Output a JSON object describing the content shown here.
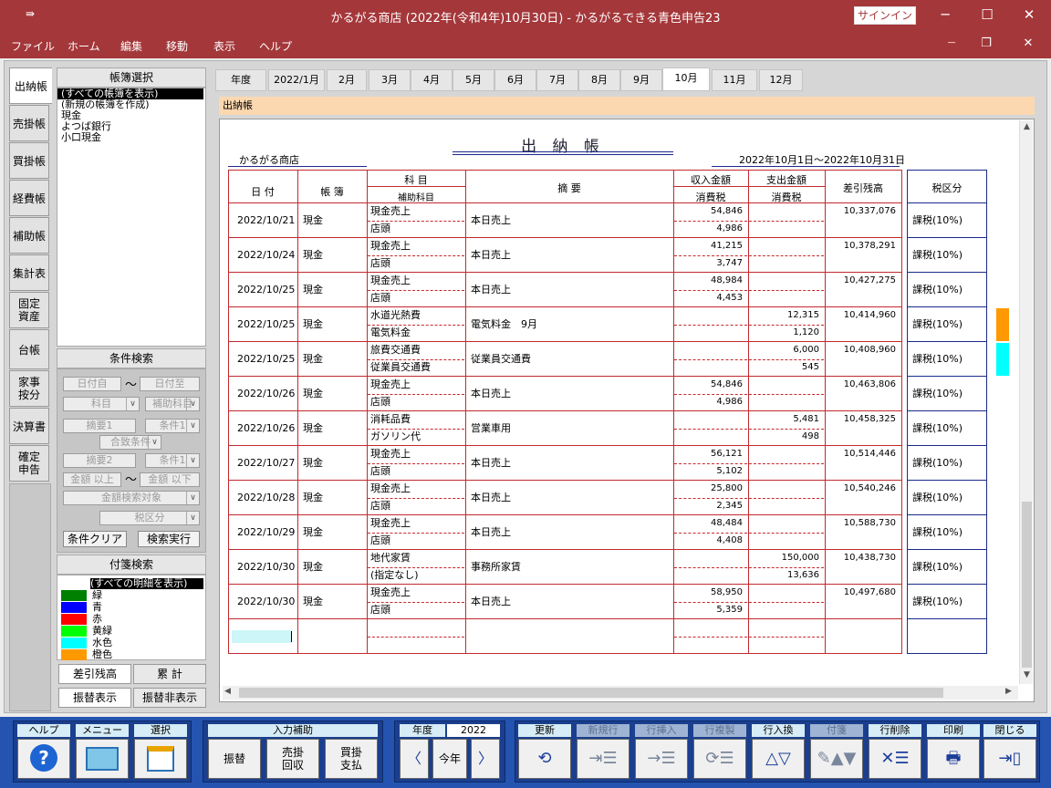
{
  "window": {
    "title": "かるがる商店 (2022年(令和4年)10月30日)  -  かるがるできる青色申告23",
    "signin": "サインイン",
    "quick_access": "⇛"
  },
  "menu": [
    "ファイル",
    "ホーム",
    "編集",
    "移動",
    "表示",
    "ヘルプ"
  ],
  "side_tabs": [
    "出納帳",
    "売掛帳",
    "買掛帳",
    "経費帳",
    "補助帳",
    "集計表",
    "固定\n資産",
    "台帳",
    "家事\n按分",
    "決算書",
    "確定\n申告"
  ],
  "book_select": {
    "header": "帳簿選択",
    "items": [
      "(すべての帳簿を表示)",
      "(新規の帳簿を作成)",
      "現金",
      "よつば銀行",
      "小口現金"
    ]
  },
  "cond_search": {
    "header": "条件検索",
    "date_from": "日付自",
    "date_to": "日付至",
    "tilde": "〜",
    "kamoku": "科目",
    "hojo": "補助科目",
    "tekiyo1": "摘要1",
    "joken1": "条件1",
    "match": "合致条件",
    "tekiyo2": "摘要2",
    "joken2": "条件1",
    "amt_from": "金額 以上",
    "amt_to": "金額 以下",
    "amt_target": "金額検索対象",
    "tax": "税区分",
    "clear_btn": "条件クリア",
    "search_btn": "検索実行"
  },
  "tag_search": {
    "header": "付箋検索",
    "all": "(すべての明細を表示)",
    "tags": [
      {
        "label": "緑",
        "color": "#008000"
      },
      {
        "label": "青",
        "color": "#0000ff"
      },
      {
        "label": "赤",
        "color": "#ff0000"
      },
      {
        "label": "黄緑",
        "color": "#00ff00"
      },
      {
        "label": "水色",
        "color": "#00ffff"
      },
      {
        "label": "橙色",
        "color": "#ff9900"
      }
    ]
  },
  "bottom_tabs": [
    "差引残高",
    "累 計",
    "振替表示",
    "振替非表示"
  ],
  "month_tabs": [
    "年度",
    "2022/1月",
    "2月",
    "3月",
    "4月",
    "5月",
    "6月",
    "7月",
    "8月",
    "9月",
    "10月",
    "11月",
    "12月"
  ],
  "section_title": "出納帳",
  "ledger": {
    "title": "出 納 帳",
    "shop": "かるがる商店",
    "period": "2022年10月1日～2022年10月31日",
    "headers": {
      "date": "日 付",
      "book": "帳 簿",
      "kamoku": "科 目",
      "hojo": "補助科目",
      "tekiyo": "摘   要",
      "income": "収入金額",
      "income_tax": "消費税",
      "expense": "支出金額",
      "expense_tax": "消費税",
      "balance": "差引残高",
      "tax": "税区分"
    },
    "rows": [
      {
        "date": "2022/10/21",
        "book": "現金",
        "kamoku": "現金売上",
        "hojo": "店頭",
        "tekiyo": "本日売上",
        "income": "54,846",
        "income_tax": "4,986",
        "expense": "",
        "expense_tax": "",
        "balance": "10,337,076",
        "tax": "課税(10%)"
      },
      {
        "date": "2022/10/24",
        "book": "現金",
        "kamoku": "現金売上",
        "hojo": "店頭",
        "tekiyo": "本日売上",
        "income": "41,215",
        "income_tax": "3,747",
        "expense": "",
        "expense_tax": "",
        "balance": "10,378,291",
        "tax": "課税(10%)"
      },
      {
        "date": "2022/10/25",
        "book": "現金",
        "kamoku": "現金売上",
        "hojo": "店頭",
        "tekiyo": "本日売上",
        "income": "48,984",
        "income_tax": "4,453",
        "expense": "",
        "expense_tax": "",
        "balance": "10,427,275",
        "tax": "課税(10%)"
      },
      {
        "date": "2022/10/25",
        "book": "現金",
        "kamoku": "水道光熱費",
        "hojo": "電気料金",
        "tekiyo": "電気料金　9月",
        "income": "",
        "income_tax": "",
        "expense": "12,315",
        "expense_tax": "1,120",
        "balance": "10,414,960",
        "tax": "課税(10%)"
      },
      {
        "date": "2022/10/25",
        "book": "現金",
        "kamoku": "旅費交通費",
        "hojo": "従業員交通費",
        "tekiyo": "従業員交通費",
        "income": "",
        "income_tax": "",
        "expense": "6,000",
        "expense_tax": "545",
        "balance": "10,408,960",
        "tax": "課税(10%)"
      },
      {
        "date": "2022/10/26",
        "book": "現金",
        "kamoku": "現金売上",
        "hojo": "店頭",
        "tekiyo": "本日売上",
        "income": "54,846",
        "income_tax": "4,986",
        "expense": "",
        "expense_tax": "",
        "balance": "10,463,806",
        "tax": "課税(10%)"
      },
      {
        "date": "2022/10/26",
        "book": "現金",
        "kamoku": "消耗品費",
        "hojo": "ガソリン代",
        "tekiyo": "営業車用",
        "income": "",
        "income_tax": "",
        "expense": "5,481",
        "expense_tax": "498",
        "balance": "10,458,325",
        "tax": "課税(10%)"
      },
      {
        "date": "2022/10/27",
        "book": "現金",
        "kamoku": "現金売上",
        "hojo": "店頭",
        "tekiyo": "本日売上",
        "income": "56,121",
        "income_tax": "5,102",
        "expense": "",
        "expense_tax": "",
        "balance": "10,514,446",
        "tax": "課税(10%)"
      },
      {
        "date": "2022/10/28",
        "book": "現金",
        "kamoku": "現金売上",
        "hojo": "店頭",
        "tekiyo": "本日売上",
        "income": "25,800",
        "income_tax": "2,345",
        "expense": "",
        "expense_tax": "",
        "balance": "10,540,246",
        "tax": "課税(10%)"
      },
      {
        "date": "2022/10/29",
        "book": "現金",
        "kamoku": "現金売上",
        "hojo": "店頭",
        "tekiyo": "本日売上",
        "income": "48,484",
        "income_tax": "4,408",
        "expense": "",
        "expense_tax": "",
        "balance": "10,588,730",
        "tax": "課税(10%)"
      },
      {
        "date": "2022/10/30",
        "book": "現金",
        "kamoku": "地代家賃",
        "hojo": "(指定なし)",
        "tekiyo": "事務所家賃",
        "income": "",
        "income_tax": "",
        "expense": "150,000",
        "expense_tax": "13,636",
        "balance": "10,438,730",
        "tax": "課税(10%)"
      },
      {
        "date": "2022/10/30",
        "book": "現金",
        "kamoku": "現金売上",
        "hojo": "店頭",
        "tekiyo": "本日売上",
        "income": "58,950",
        "income_tax": "5,359",
        "expense": "",
        "expense_tax": "",
        "balance": "10,497,680",
        "tax": "課税(10%)"
      }
    ]
  },
  "toolbar": {
    "help": "ヘルプ",
    "menu": "メニュー",
    "select": "選択",
    "input_assist": "入力補助",
    "furikae": "振替",
    "urikake": "売掛\n回収",
    "kaikake": "買掛\n支払",
    "nendo": "年度",
    "year": "2022",
    "this_year": "今年",
    "update": "更新",
    "new_row": "新規行",
    "insert_row": "行挿入",
    "dup_row": "行複製",
    "swap_row": "行入換",
    "tag": "付箋",
    "delete_row": "行削除",
    "print": "印刷",
    "close": "閉じる"
  }
}
